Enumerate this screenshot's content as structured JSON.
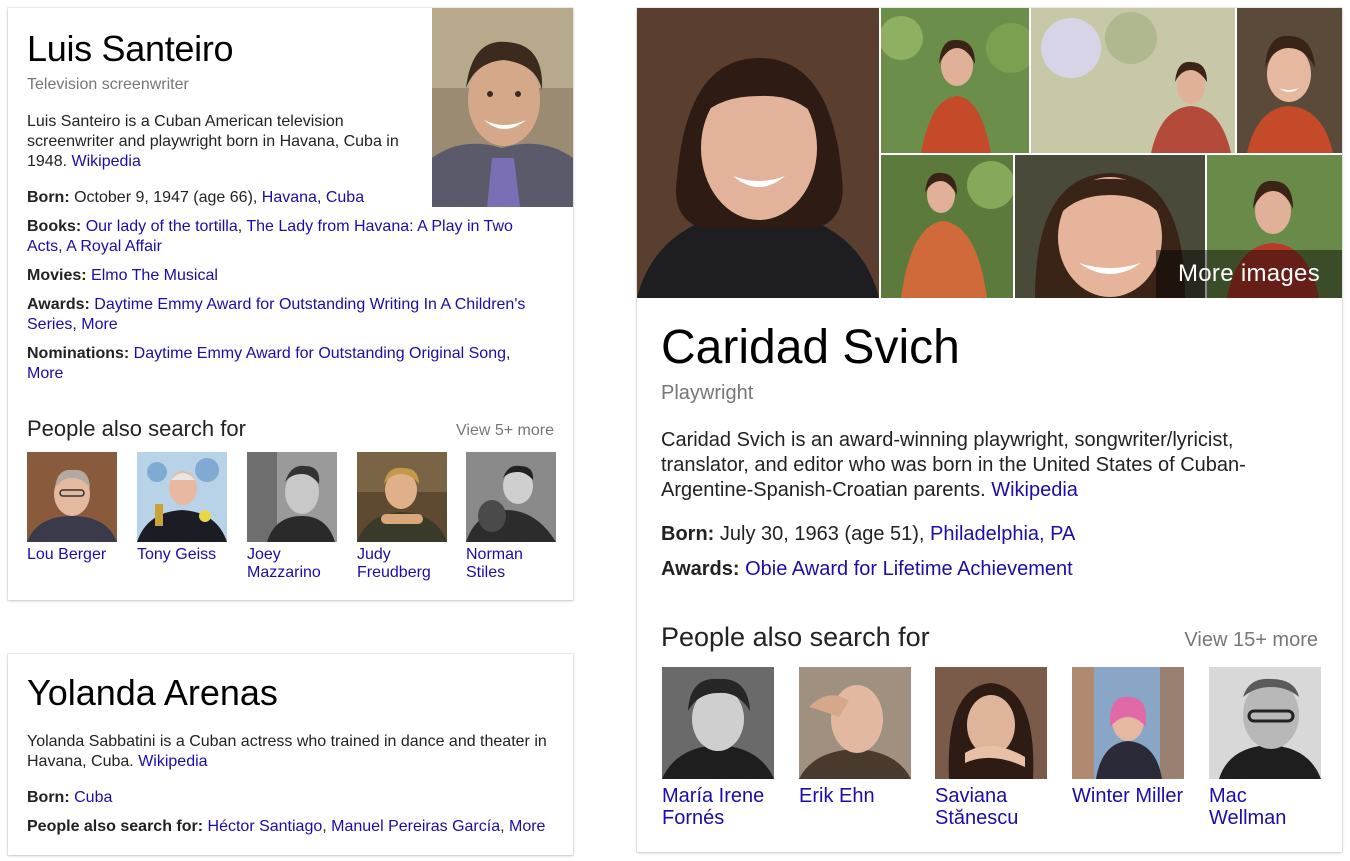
{
  "card1": {
    "name": "Luis Santeiro",
    "subtitle": "Television screenwriter",
    "description": "Luis Santeiro is a Cuban American television screenwriter and playwright born in Havana, Cuba in 1948.",
    "wiki_link": "Wikipedia",
    "born": {
      "label": "Born:",
      "text": "October 9, 1947 (age 66),",
      "link": "Havana, Cuba"
    },
    "books": {
      "label": "Books:",
      "links": [
        "Our lady of the tortilla",
        "The Lady from Havana: A Play in Two Acts",
        "A Royal Affair"
      ]
    },
    "movies": {
      "label": "Movies:",
      "link": "Elmo The Musical"
    },
    "awards": {
      "label": "Awards:",
      "link": "Daytime Emmy Award for Outstanding Writing In A Children's Series",
      "more": "More"
    },
    "nominations": {
      "label": "Nominations:",
      "link": "Daytime Emmy Award for Outstanding Original Song",
      "more": "More"
    },
    "people_heading": "People also search for",
    "view_more": "View 5+ more",
    "people": [
      {
        "name": "Lou Berger"
      },
      {
        "name": "Tony Geiss"
      },
      {
        "name": "Joey Mazzarino"
      },
      {
        "name": "Judy Freudberg"
      },
      {
        "name": "Norman Stiles"
      }
    ]
  },
  "card2": {
    "name": "Yolanda Arenas",
    "description": "Yolanda Sabbatini is a Cuban actress who trained in dance and theater in Havana, Cuba.",
    "wiki_link": "Wikipedia",
    "born": {
      "label": "Born:",
      "link": "Cuba"
    },
    "pas": {
      "label": "People also search for:",
      "links": [
        "Héctor Santiago",
        "Manuel Pereiras García"
      ],
      "more": "More"
    }
  },
  "card3": {
    "name": "Caridad Svich",
    "subtitle": "Playwright",
    "description": "Caridad Svich is an award-winning playwright, songwriter/lyricist, translator, and editor who was born in the United States of Cuban-Argentine-Spanish-Croatian parents.",
    "wiki_link": "Wikipedia",
    "born": {
      "label": "Born:",
      "text": "July 30, 1963 (age 51),",
      "link": "Philadelphia, PA"
    },
    "awards": {
      "label": "Awards:",
      "link": "Obie Award for Lifetime Achievement"
    },
    "more_images": "More images",
    "people_heading": "People also search for",
    "view_more": "View 15+ more",
    "people": [
      {
        "name": "María Irene Fornés"
      },
      {
        "name": "Erik Ehn"
      },
      {
        "name": "Saviana Stănescu"
      },
      {
        "name": "Winter Miller"
      },
      {
        "name": "Mac Wellman"
      }
    ]
  }
}
